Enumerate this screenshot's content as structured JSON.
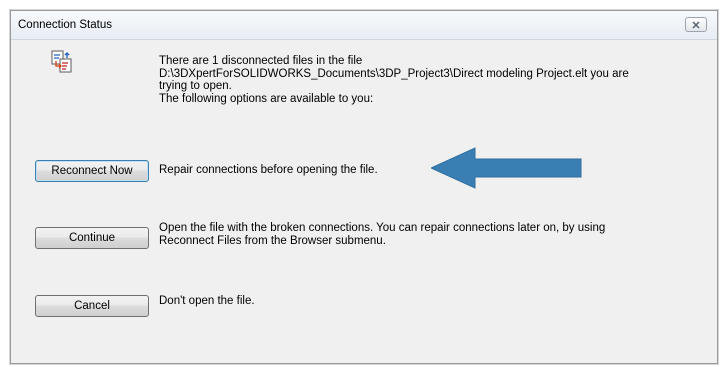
{
  "window": {
    "title": "Connection Status",
    "close_icon": "close-icon"
  },
  "message": {
    "lines": [
      "There are 1 disconnected files in the file",
      "D:\\3DXpertForSOLIDWORKS_Documents\\3DP_Project3\\Direct modeling Project.elt  you are",
      "trying to open.",
      "The following options are available to you:"
    ]
  },
  "options": [
    {
      "button_label": "Reconnect Now",
      "description_lines": [
        "Repair connections before opening the file."
      ]
    },
    {
      "button_label": "Continue",
      "description_lines": [
        "Open the file with the broken connections. You can repair connections later on, by using",
        "Reconnect Files from the Browser submenu."
      ]
    },
    {
      "button_label": "Cancel",
      "description_lines": [
        "Don't open the file."
      ]
    }
  ],
  "annotation": {
    "arrow_color": "#3a7fb4",
    "arrow_direction": "left"
  },
  "icons": {
    "app_icon": "disconnected-files-icon"
  }
}
